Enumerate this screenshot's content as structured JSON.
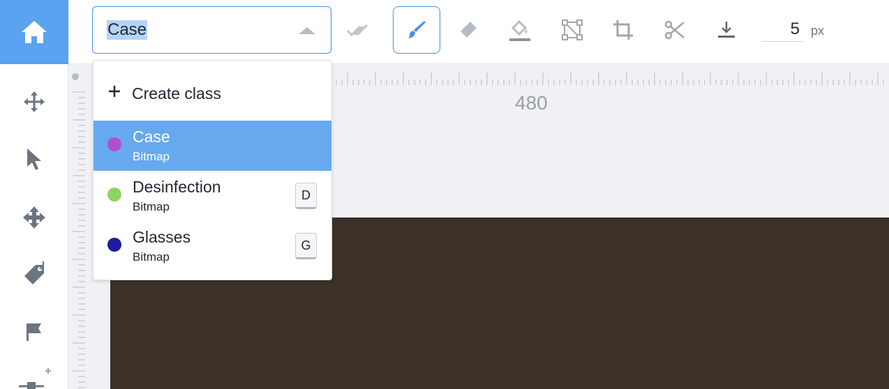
{
  "toolbar": {
    "class_select": {
      "value": "Case"
    },
    "tools": [
      {
        "name": "approve",
        "icon": "double-check-icon"
      },
      {
        "name": "brush",
        "icon": "brush-icon",
        "active": true
      },
      {
        "name": "eraser",
        "icon": "eraser-icon"
      },
      {
        "name": "fill",
        "icon": "paint-bucket-icon"
      },
      {
        "name": "polygon",
        "icon": "polygon-points-icon"
      },
      {
        "name": "crop",
        "icon": "crop-icon"
      },
      {
        "name": "cut",
        "icon": "scissors-icon"
      },
      {
        "name": "download",
        "icon": "download-icon"
      }
    ],
    "brush_size": "5",
    "brush_unit": "px"
  },
  "sidebar": {
    "tools": [
      "home-icon",
      "move-icon",
      "pointer-icon",
      "pan-icon",
      "tag-icon",
      "flag-icon",
      "add-point-icon"
    ]
  },
  "ruler": {
    "label": "480"
  },
  "dropdown": {
    "create_label": "Create class",
    "options": [
      {
        "name": "Case",
        "type": "Bitmap",
        "color": "#b24fcf",
        "shortcut": "",
        "selected": true
      },
      {
        "name": "Desinfection",
        "type": "Bitmap",
        "color": "#8fd364",
        "shortcut": "D"
      },
      {
        "name": "Glasses",
        "type": "Bitmap",
        "color": "#1c1c9e",
        "shortcut": "G"
      }
    ]
  },
  "colors": {
    "accent": "#4a90e2",
    "selected_row": "#67a9ee",
    "home_bg": "#5aa3f0"
  }
}
